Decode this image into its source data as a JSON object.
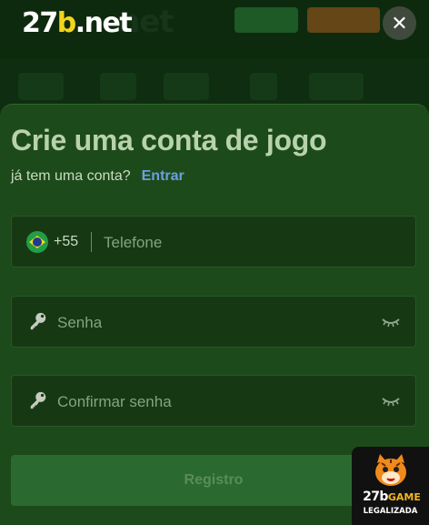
{
  "header": {
    "logo_main": "27",
    "logo_accent": "b",
    "logo_suffix": ".net",
    "close_symbol": "✕"
  },
  "form": {
    "title": "Crie uma conta de jogo",
    "login_prompt": "já tem uma conta?",
    "login_link": "Entrar",
    "phone": {
      "dial_code": "+55",
      "placeholder": "Telefone",
      "value": ""
    },
    "password": {
      "placeholder": "Senha",
      "value": ""
    },
    "confirm_password": {
      "placeholder": "Confirmar senha",
      "value": ""
    },
    "submit_label": "Registro"
  },
  "badge": {
    "brand_number": "27b",
    "brand_word": "GAME",
    "subtitle": "LEGALIZADA"
  },
  "colors": {
    "sheet_background": "#1d4a1a",
    "field_background": "#163914",
    "link": "#6c9fe0",
    "submit_background": "#2a6a30",
    "logo_accent": "#f2d51b"
  },
  "icons": {
    "close": "close-icon",
    "flag": "brazil-flag-icon",
    "key": "key-icon",
    "eye": "eye-closed-icon",
    "mascot": "tiger-mascot-icon"
  }
}
